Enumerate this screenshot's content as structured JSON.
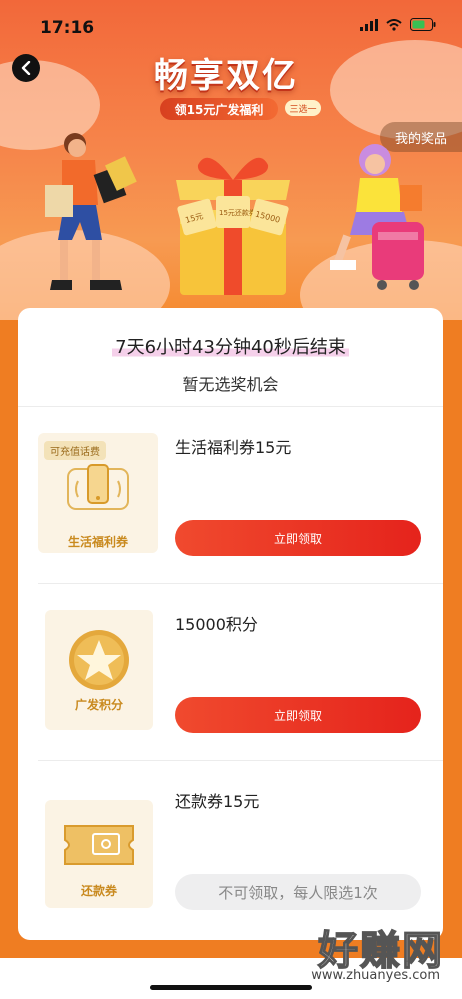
{
  "status_bar": {
    "time": "17:16"
  },
  "hero": {
    "title": "畅享双亿",
    "subtitle": "领15元广发福利",
    "choice_tag": "三选一",
    "my_prizes_label": "我的奖品",
    "gift_tickets": [
      "15元",
      "15元还款券",
      "15000"
    ]
  },
  "card": {
    "countdown": "7天6小时43分钟40秒后结束",
    "no_chance_text": "暂无选奖机会",
    "items": [
      {
        "name": "生活福利券15元",
        "thumb_chip": "可充值话费",
        "thumb_label": "生活福利券",
        "button_label": "立即领取"
      },
      {
        "name": "15000积分",
        "thumb_label": "广发积分",
        "button_label": "立即领取"
      },
      {
        "name": "还款券15元",
        "thumb_label": "还款券",
        "button_label": "不可领取，每人限选1次"
      }
    ]
  },
  "watermark": {
    "text": "好赚网",
    "url": "www.zhuanyes.com"
  },
  "colors": {
    "accent": "#e5231c",
    "background": "#ef7d22",
    "gold": "#c98a1f"
  }
}
